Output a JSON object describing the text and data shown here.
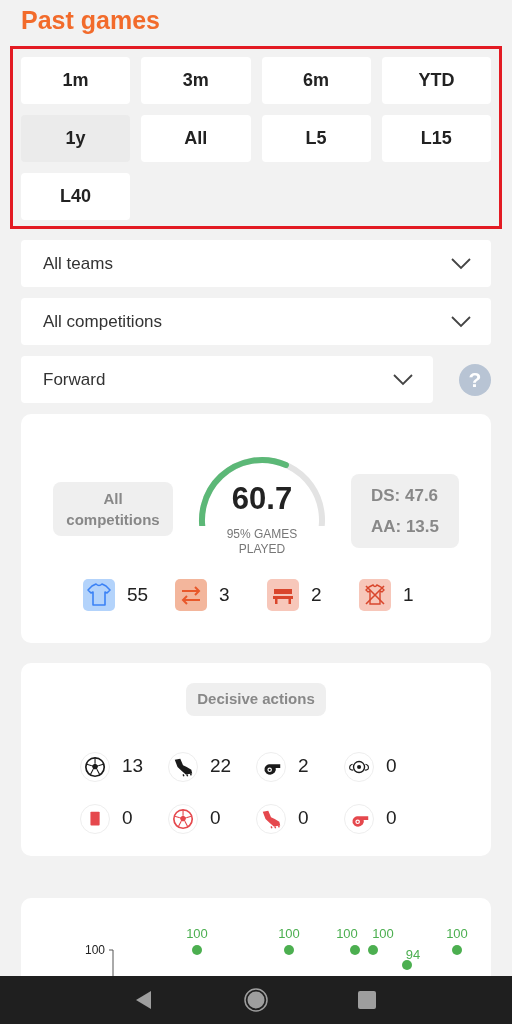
{
  "header": {
    "title": "Past games"
  },
  "period_buttons": [
    {
      "label": "1m",
      "selected": false
    },
    {
      "label": "3m",
      "selected": false
    },
    {
      "label": "6m",
      "selected": false
    },
    {
      "label": "YTD",
      "selected": false
    },
    {
      "label": "1y",
      "selected": true
    },
    {
      "label": "All",
      "selected": false
    },
    {
      "label": "L5",
      "selected": false
    },
    {
      "label": "L15",
      "selected": false
    },
    {
      "label": "L40",
      "selected": false
    }
  ],
  "filters": [
    {
      "value": "All teams"
    },
    {
      "value": "All competitions"
    },
    {
      "value": "Forward",
      "help": "?"
    }
  ],
  "summary": {
    "competition": "All competitions",
    "score": "60.7",
    "caption": "95% GAMES PLAYED",
    "ds": "DS: 47.6",
    "aa": "AA: 13.5",
    "stats": [
      {
        "kind": "starter",
        "value": "55"
      },
      {
        "kind": "substitute",
        "value": "3"
      },
      {
        "kind": "bench",
        "value": "2"
      },
      {
        "kind": "not_in_squad",
        "value": "1"
      }
    ]
  },
  "decisive_actions": {
    "title": "Decisive actions",
    "items": [
      {
        "kind": "ball",
        "negative": false,
        "value": "13"
      },
      {
        "kind": "boot",
        "negative": false,
        "value": "22"
      },
      {
        "kind": "whistle",
        "negative": false,
        "value": "2"
      },
      {
        "kind": "winged_ball",
        "negative": false,
        "value": "0"
      },
      {
        "kind": "card",
        "negative": true,
        "value": "0"
      },
      {
        "kind": "ball",
        "negative": true,
        "value": "0"
      },
      {
        "kind": "boot",
        "negative": true,
        "value": "0"
      },
      {
        "kind": "whistle",
        "negative": true,
        "value": "0"
      }
    ]
  },
  "history_chart": {
    "axis_label": "100",
    "points": [
      {
        "label": "100"
      },
      {
        "label": "100"
      },
      {
        "label": "100"
      },
      {
        "label": "100"
      },
      {
        "label": "94"
      },
      {
        "label": "100"
      }
    ]
  }
}
